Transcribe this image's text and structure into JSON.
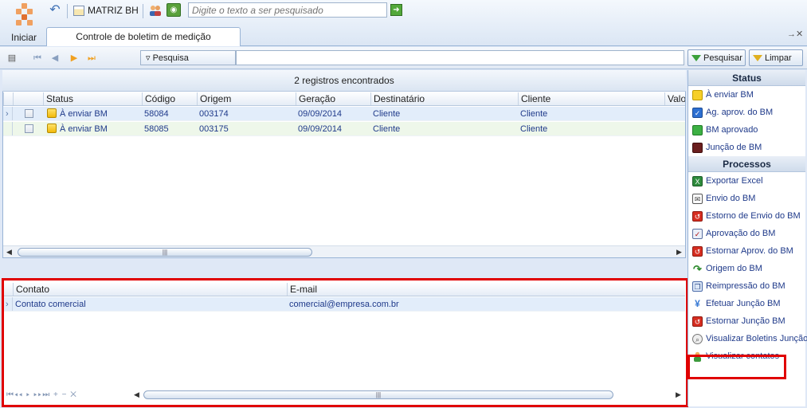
{
  "ribbon": {
    "start_label": "Iniciar",
    "branch": "MATRIZ BH",
    "search_placeholder": "Digite o texto a ser pesquisado"
  },
  "tab": {
    "label": "Controle de boletim de medição"
  },
  "toolbar": {
    "search_field": "Pesquisa",
    "search_button": "Pesquisar",
    "clear_button": "Limpar"
  },
  "grid": {
    "summary": "2 registros encontrados",
    "columns": [
      "Status",
      "Código",
      "Origem",
      "Geração",
      "Destinatário",
      "Cliente",
      "Valor"
    ],
    "rows": [
      {
        "status": "À enviar BM",
        "codigo": "58084",
        "origem": "003174",
        "geracao": "09/09/2014",
        "destinatario": "Cliente",
        "cliente": "Cliente"
      },
      {
        "status": "À enviar BM",
        "codigo": "58085",
        "origem": "003175",
        "geracao": "09/09/2014",
        "destinatario": "Cliente",
        "cliente": "Cliente"
      }
    ]
  },
  "contacts": {
    "columns": [
      "Contato",
      "E-mail"
    ],
    "rows": [
      {
        "contato": "Contato comercial",
        "email": "comercial@empresa.com.br"
      }
    ]
  },
  "side": {
    "status_header": "Status",
    "status_items": [
      {
        "label": "À enviar BM",
        "icon": "yellow-square-icon"
      },
      {
        "label": "Ag. aprov. do BM",
        "icon": "blue-check-icon"
      },
      {
        "label": "BM aprovado",
        "icon": "green-square-icon"
      },
      {
        "label": "Junção de BM",
        "icon": "brown-square-icon"
      }
    ],
    "process_header": "Processos",
    "process_items": [
      {
        "label": "Exportar Excel",
        "icon": "excel-icon"
      },
      {
        "label": "Envio do BM",
        "icon": "envelope-icon"
      },
      {
        "label": "Estorno de Envio do BM",
        "icon": "undo-red-icon"
      },
      {
        "label": "Aprovação do BM",
        "icon": "document-approve-icon"
      },
      {
        "label": "Estornar Aprov. do BM",
        "icon": "undo-red-icon"
      },
      {
        "label": "Origem do BM",
        "icon": "green-arrow-icon"
      },
      {
        "label": "Reimpressão do BM",
        "icon": "copy-document-icon"
      },
      {
        "label": "Efetuar Junção BM",
        "icon": "merge-icon"
      },
      {
        "label": "Estornar Junção BM",
        "icon": "undo-red-icon"
      },
      {
        "label": "Visualizar Boletins Junção",
        "icon": "magnifier-icon"
      },
      {
        "label": "Visualizar contatos",
        "icon": "person-icon"
      }
    ]
  },
  "colors": {
    "highlight_frame": "#e00000",
    "link_text": "#1f3a8a",
    "panel_bg": "#dfe8f6"
  }
}
